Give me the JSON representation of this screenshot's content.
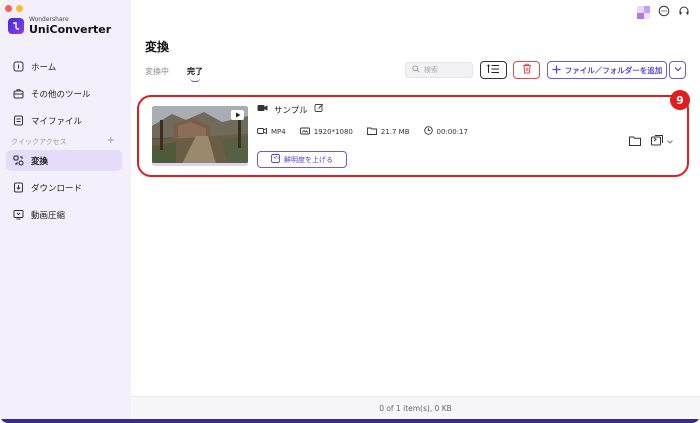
{
  "app": {
    "brand_small": "Wondershare",
    "brand_name": "UniConverter"
  },
  "sidebar": {
    "items_top": [
      {
        "label": "ホーム",
        "icon": "home-icon"
      },
      {
        "label": "その他のツール",
        "icon": "toolbox-icon"
      },
      {
        "label": "マイファイル",
        "icon": "file-icon"
      }
    ],
    "quick_access_label": "クイックアクセス",
    "quick_access_add": "+",
    "items_quick": [
      {
        "label": "変換",
        "icon": "convert-icon",
        "active": true
      },
      {
        "label": "ダウンロード",
        "icon": "download-icon"
      },
      {
        "label": "動画圧縮",
        "icon": "compress-icon"
      }
    ]
  },
  "main": {
    "title": "変換",
    "tabs": [
      {
        "label": "変換中",
        "active": false
      },
      {
        "label": "完了",
        "active": true
      }
    ],
    "search_placeholder": "検索",
    "add_button_label": "ファイル／フォルダーを追加"
  },
  "file": {
    "name": "サンプル",
    "format": "MP4",
    "resolution": "1920*1080",
    "size": "21.7 MB",
    "duration": "00:00:17",
    "enhance_label": "鮮明度を上げる"
  },
  "annotation": {
    "badge": "9"
  },
  "footer": {
    "status": "0 of 1 item(s), 0 KB"
  },
  "colors": {
    "accent": "#6a4cf0",
    "highlight": "#e01e1e",
    "sidebar_bg": "#f3f0fb"
  }
}
